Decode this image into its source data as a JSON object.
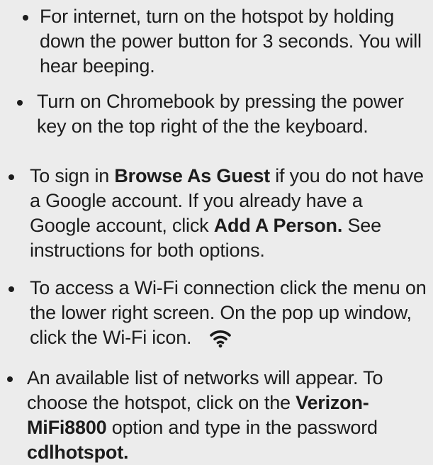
{
  "instructions": [
    {
      "lines": [
        [
          {
            "t": "For internet, turn on the hotspot by holding"
          }
        ],
        [
          {
            "t": "down the power button for 3 seconds. You will"
          }
        ],
        [
          {
            "t": "hear beeping."
          }
        ]
      ]
    },
    {
      "lines": [
        [
          {
            "t": "Turn on Chromebook by pressing the  power"
          }
        ],
        [
          {
            "t": "key on the top right of the the keyboard."
          }
        ]
      ]
    },
    {
      "lines": [
        [
          {
            "t": "To sign in "
          },
          {
            "t": "Browse As Guest",
            "b": true
          },
          {
            "t": " if you do not have"
          }
        ],
        [
          {
            "t": "a Google account.  If  you already have a"
          }
        ],
        [
          {
            "t": "Google account, click "
          },
          {
            "t": "Add A Person.",
            "b": true
          },
          {
            "t": "  See"
          }
        ],
        [
          {
            "t": "instructions for both options."
          }
        ]
      ]
    },
    {
      "lines": [
        [
          {
            "t": "To access a Wi-Fi connection click the menu on"
          }
        ],
        [
          {
            "t": "the lower right screen. On the pop up window,"
          }
        ],
        [
          {
            "t": "click the Wi-Fi icon."
          },
          {
            "icon": "wifi-icon"
          }
        ]
      ]
    },
    {
      "lines": [
        [
          {
            "t": "An available list of networks will appear.  To"
          }
        ],
        [
          {
            "t": "choose the hotspot, click on the "
          },
          {
            "t": "Verizon-",
            "b": true
          }
        ],
        [
          {
            "t": "MiFi8800",
            "b": true
          },
          {
            "t": " option and type in the password"
          }
        ],
        [
          {
            "t": "cdlhotspot.",
            "b": true
          }
        ]
      ]
    }
  ]
}
